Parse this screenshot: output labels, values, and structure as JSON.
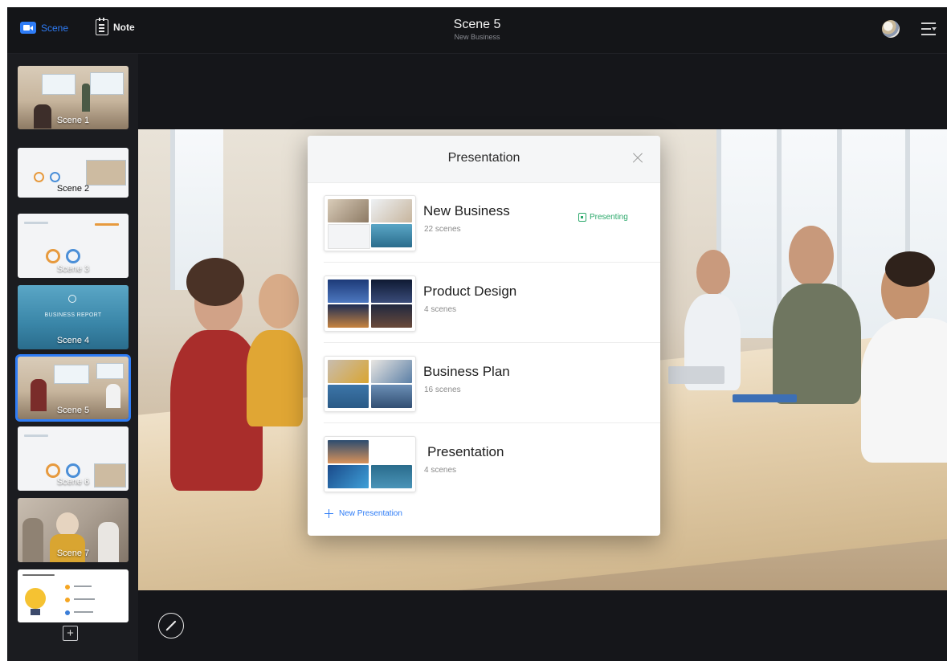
{
  "topbar": {
    "scene_tab_label": "Scene",
    "note_tab_label": "Note",
    "title": "Scene 5",
    "subtitle": "New Business",
    "accent_color": "#2e7cf6"
  },
  "sidebar": {
    "scenes": [
      {
        "label": "Scene 1"
      },
      {
        "label": "Scene 2"
      },
      {
        "label": "Scene 3"
      },
      {
        "label": "Scene 4",
        "slide_text": "BUSINESS REPORT"
      },
      {
        "label": "Scene 5",
        "active": true
      },
      {
        "label": "Scene 6"
      },
      {
        "label": "Scene 7"
      },
      {
        "label": ""
      }
    ],
    "add_label": "+"
  },
  "modal": {
    "title": "Presentation",
    "presentations": [
      {
        "name": "New Business",
        "count": "22 scenes",
        "status": "Presenting"
      },
      {
        "name": "Product Design",
        "count": "4 scenes"
      },
      {
        "name": "Business Plan",
        "count": "16 scenes"
      },
      {
        "name": "Presentation",
        "count": "4 scenes"
      }
    ],
    "new_label": "New Presentation",
    "status_color": "#2aa86a"
  },
  "icons": [
    "camera-icon",
    "note-icon",
    "avatar",
    "menu-icon",
    "close-icon",
    "presenting-icon",
    "plus-icon",
    "pen-icon"
  ]
}
